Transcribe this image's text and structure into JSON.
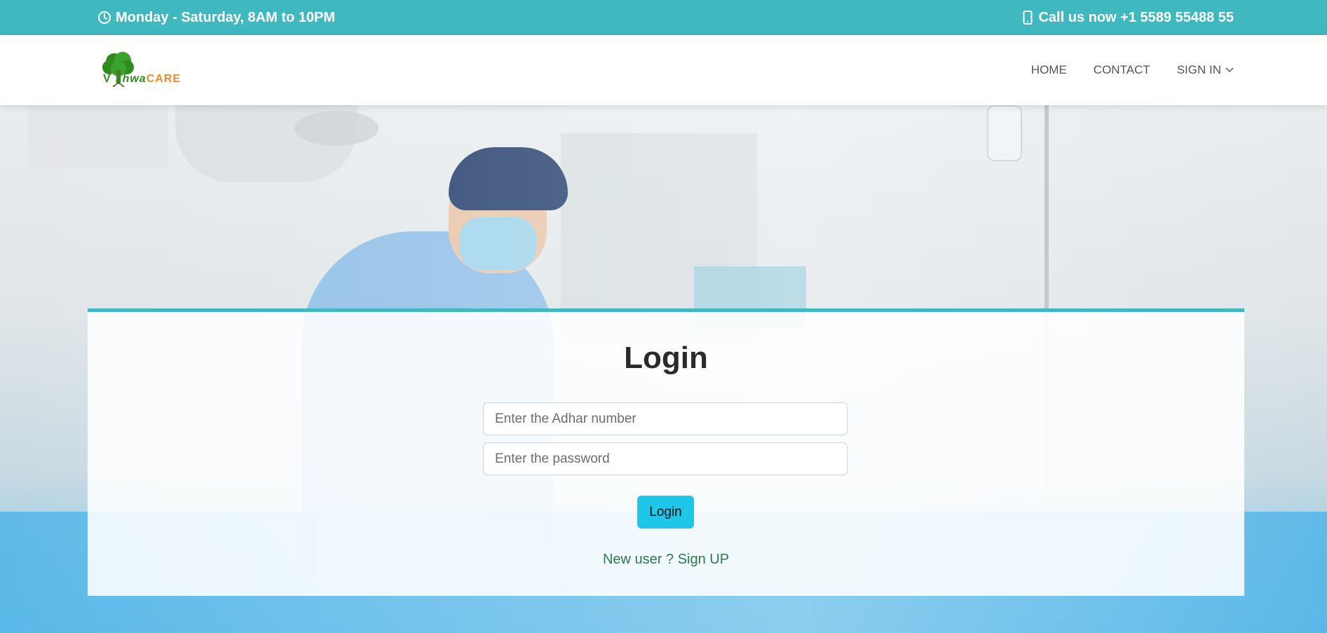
{
  "topbar": {
    "hours": "Monday - Saturday, 8AM to 10PM",
    "phone": "Call us now +1 5589 55488 55",
    "bg_color": "#3fb8c0",
    "icons": {
      "clock": "clock-icon",
      "phone": "phone-icon"
    }
  },
  "logo": {
    "brand_prefix": "V",
    "brand_middle": "shwa",
    "brand_suffix": "CARE",
    "icon": "tree-icon"
  },
  "nav": {
    "home": "HOME",
    "contact": "CONTACT",
    "signin": "SIGN IN"
  },
  "login": {
    "title": "Login",
    "adhar_placeholder": "Enter the Adhar number",
    "adhar_value": "",
    "password_placeholder": "Enter the password",
    "password_value": "",
    "button": "Login",
    "signup_link": "New user ? Sign UP",
    "accent_color": "#3fb8c0",
    "button_color": "#1ec6e8"
  }
}
